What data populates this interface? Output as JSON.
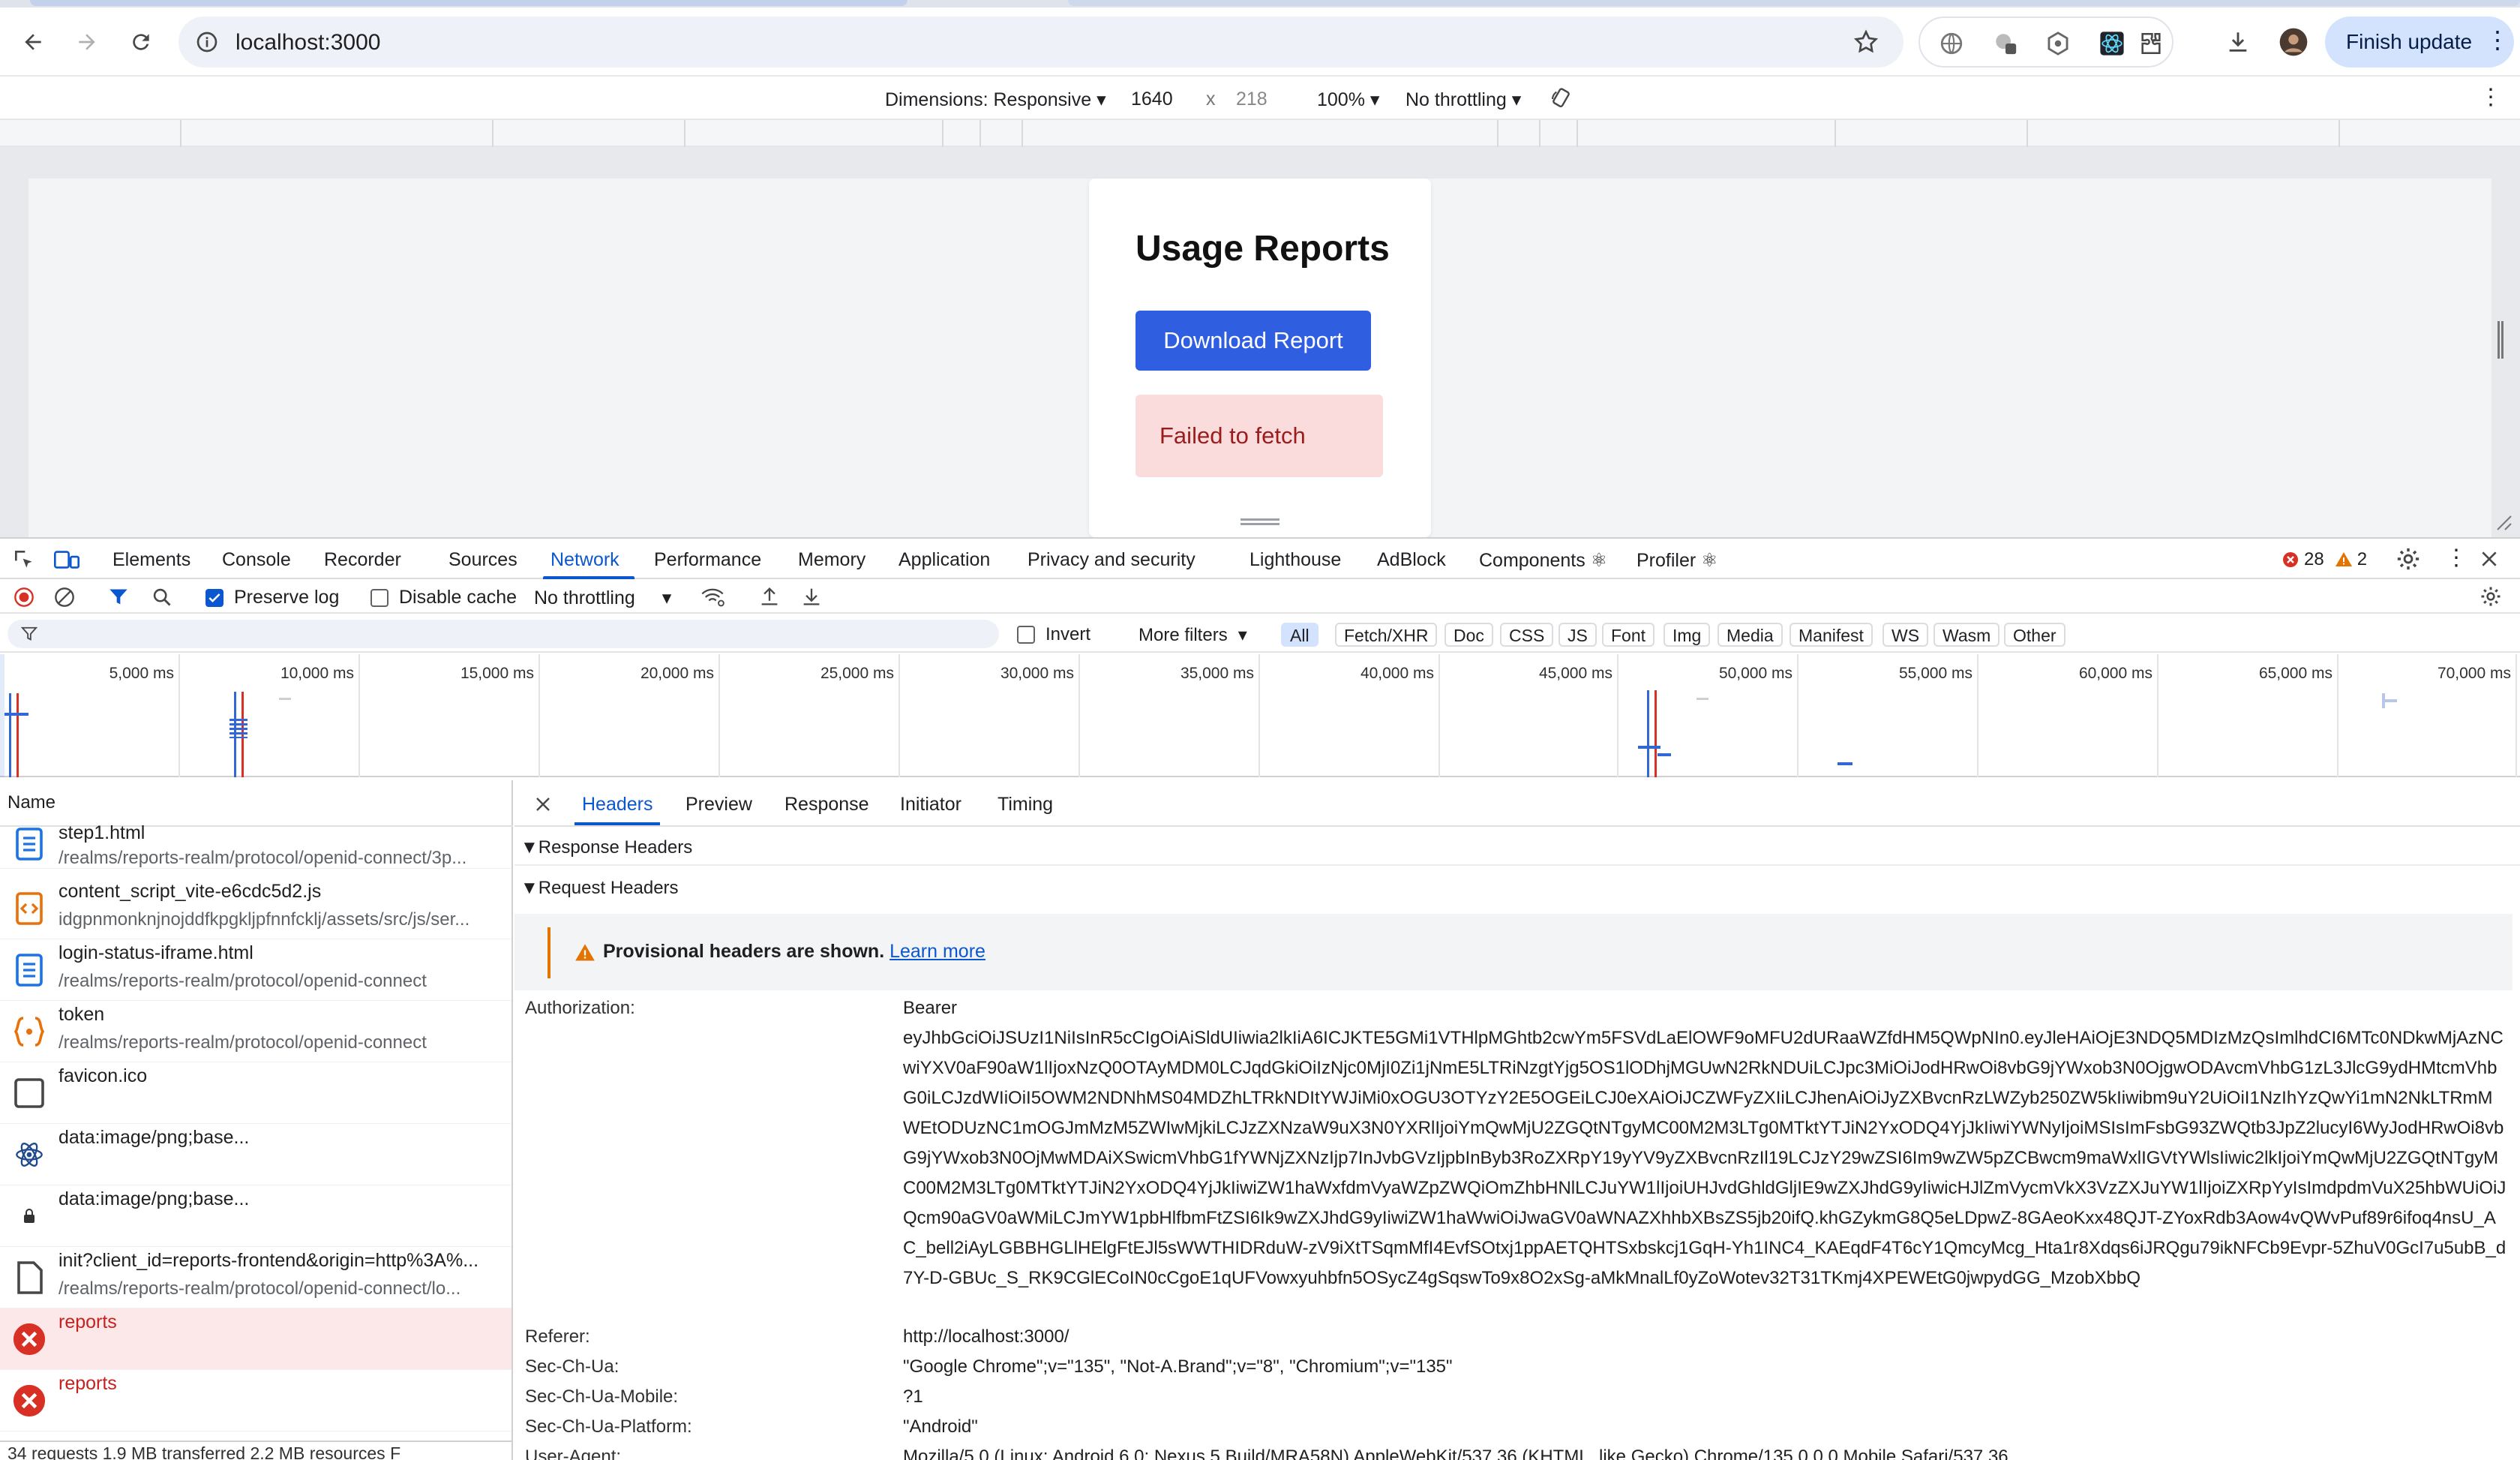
{
  "browser": {
    "url": "localhost:3000",
    "finish_update_label": "Finish update"
  },
  "device_toolbar": {
    "dimensions_label": "Dimensions: Responsive",
    "width": "1640",
    "times": "x",
    "height": "218",
    "zoom": "100%",
    "throttling": "No throttling"
  },
  "app": {
    "title": "Usage Reports",
    "download_button": "Download Report",
    "error_message": "Failed to fetch"
  },
  "devtools": {
    "tabs": [
      "Elements",
      "Console",
      "Recorder",
      "Sources",
      "Network",
      "Performance",
      "Memory",
      "Application",
      "Privacy and security",
      "Lighthouse",
      "AdBlock",
      "Components ⚛",
      "Profiler ⚛"
    ],
    "active_tab": "Network",
    "error_count": "28",
    "warning_count": "2"
  },
  "network_toolbar": {
    "preserve_log": "Preserve log",
    "preserve_log_checked": true,
    "disable_cache": "Disable cache",
    "throttling": "No throttling"
  },
  "filter_bar": {
    "invert": "Invert",
    "more_filters": "More filters",
    "types": [
      "All",
      "Fetch/XHR",
      "Doc",
      "CSS",
      "JS",
      "Font",
      "Img",
      "Media",
      "Manifest",
      "WS",
      "Wasm",
      "Other"
    ],
    "active_type": "All"
  },
  "timeline": {
    "labels": [
      "5,000 ms",
      "10,000 ms",
      "15,000 ms",
      "20,000 ms",
      "25,000 ms",
      "30,000 ms",
      "35,000 ms",
      "40,000 ms",
      "45,000 ms",
      "50,000 ms",
      "55,000 ms",
      "60,000 ms",
      "65,000 ms",
      "70,000 ms"
    ]
  },
  "requests": {
    "column_name": "Name",
    "items": [
      {
        "name": "step1.html",
        "path": "/realms/reports-realm/protocol/openid-connect/3p...",
        "icon": "document-icon",
        "status": "ok"
      },
      {
        "name": "content_script_vite-e6cdc5d2.js",
        "path": "idgpnmonknjnojddfkpgkljpfnnfcklj/assets/src/js/ser...",
        "icon": "script-icon",
        "status": "ok"
      },
      {
        "name": "login-status-iframe.html",
        "path": "/realms/reports-realm/protocol/openid-connect",
        "icon": "document-icon",
        "status": "ok"
      },
      {
        "name": "token",
        "path": "/realms/reports-realm/protocol/openid-connect",
        "icon": "fetch-icon",
        "status": "ok"
      },
      {
        "name": "favicon.ico",
        "path": "",
        "icon": "image-icon",
        "status": "ok"
      },
      {
        "name": "data:image/png;base...",
        "path": "",
        "icon": "react-icon",
        "status": "ok"
      },
      {
        "name": "data:image/png;base...",
        "path": "",
        "icon": "lock-icon",
        "status": "ok"
      },
      {
        "name": "init?client_id=reports-frontend&origin=http%3A%...",
        "path": "/realms/reports-realm/protocol/openid-connect/lo...",
        "icon": "file-icon",
        "status": "ok"
      },
      {
        "name": "reports",
        "path": "",
        "icon": "error-icon",
        "status": "error"
      },
      {
        "name": "reports",
        "path": "",
        "icon": "error-icon",
        "status": "error"
      }
    ],
    "summary": "34 requests   1.9 MB transferred   2.2 MB resources   F"
  },
  "details": {
    "tabs": [
      "Headers",
      "Preview",
      "Response",
      "Initiator",
      "Timing"
    ],
    "active_tab": "Headers",
    "response_headers": "▼Response Headers",
    "request_headers": "▼Request Headers",
    "warning_text": "Provisional headers are shown.",
    "learn_more": "Learn more",
    "headers": {
      "authorization_name": "Authorization:",
      "authorization_value": "Bearer",
      "token": "eyJhbGciOiJSUzI1NiIsInR5cCIgOiAiSldUIiwia2lkIiA6ICJKTE5GMi1VTHlpMGhtb2cwYm5FSVdLaElOWF9oMFU2dURaaWZfdHM5QWpNIn0.eyJleHAiOjE3NDQ5MDIzMzQsImlhdCI6MTc0NDkwMjAzNCwiYXV0aF90aW1lIjoxNzQ0OTAyMDM0LCJqdGkiOiIzNjc0MjI0Zi1jNmE5LTRiNzgtYjg5OS1lODhjMGUwN2RkNDUiLCJpc3MiOiJodHRwOi8vbG9jYWxob3N0OjgwODAvcmVhbG1zL3JlcG9ydHMtcmVhbG0iLCJzdWIiOiI5OWM2NDNhMS04MDZhLTRkNDItYWJiMi0xOGU3OTYzY2E5OGEiLCJ0eXAiOiJCZWFyZXIiLCJhenAiOiJyZXBvcnRzLWZyb250ZW5kIiwibm9uY2UiOiI1NzIhYzQwYi1mN2NkLTRmMWEtODUzNC1mOGJmMzM5ZWIwMjkiLCJzZXNzaW9uX3N0YXRlIjoiYmQwMjU2ZGQtNTgyMC00M2M3LTg0MTktYTJiN2YxODQ4YjJkIiwiYWNyIjoiMSIsImFsbG93ZWQtb3JpZ2lucyI6WyJodHRwOi8vbG9jYWxob3N0OjMwMDAiXSwicmVhbG1fYWNjZXNzIjp7InJvbGVzIjpbInByb3RoZXRpY19yYV9yZXBvcnRzIl19LCJzY29wZSI6Im9wZW5pZCBwcm9maWxlIGVtYWlsIiwic2lkIjoiYmQwMjU2ZGQtNTgyMC00M2M3LTg0MTktYTJiN2YxODQ4YjJkIiwiZW1haWxfdmVyaWZpZWQiOmZhbHNlLCJuYW1lIjoiUHJvdGhldGljIE9wZXJhdG9yIiwicHJlZmVycmVkX3VzZXJuYW1lIjoiZXRpYyIsImdpdmVuX25hbWUiOiJQcm90aGV0aWMiLCJmYW1pbHlfbmFtZSI6Ik9wZXJhdG9yIiwiZW1haWwiOiJwaGV0aWNAZXhhbXBsZS5jb20ifQ.khGZykmG8Q5eLDpwZ-8GAeoKxx48QJT-ZYoxRdb3Aow4vQWvPuf89r6ifoq4nsU_AC_bell2iAyLGBBHGLlHElgFtEJl5sWWTHIDRduW-zV9iXtTSqmMfI4EvfSOtxj1ppAETQHTSxbskcj1GqH-Yh1INC4_KAEqdF4T6cY1QmcyMcg_Hta1r8Xdqs6iJRQgu79ikNFCb9Evpr-5ZhuV0GcI7u5ubB_d7Y-D-GBUc_S_RK9CGlECoIN0cCgoE1qUFVowxyuhbfn5OSycZ4gSqswTo9x8O2xSg-aMkMnalLf0yZoWotev32T31TKmj4XPEWEtG0jwpydGG_MzobXbbQ",
      "referer_name": "Referer:",
      "referer_value": "http://localhost:3000/",
      "ua_name": "Sec-Ch-Ua:",
      "ua_value": "\"Google Chrome\";v=\"135\", \"Not-A.Brand\";v=\"8\", \"Chromium\";v=\"135\"",
      "mobile_name": "Sec-Ch-Ua-Mobile:",
      "mobile_value": "?1",
      "platform_name": "Sec-Ch-Ua-Platform:",
      "platform_value": "\"Android\"",
      "useragent_name": "User-Agent:",
      "useragent_value": "Mozilla/5.0 (Linux; Android 6.0; Nexus 5 Build/MRA58N) AppleWebKit/537.36 (KHTML, like Gecko) Chrome/135.0.0.0 Mobile Safari/537.36"
    }
  },
  "colors": {
    "accent": "#0b57d0",
    "button": "#2f5ee0",
    "error_bg": "#fadcdc",
    "error_text": "#9b1c1c"
  }
}
